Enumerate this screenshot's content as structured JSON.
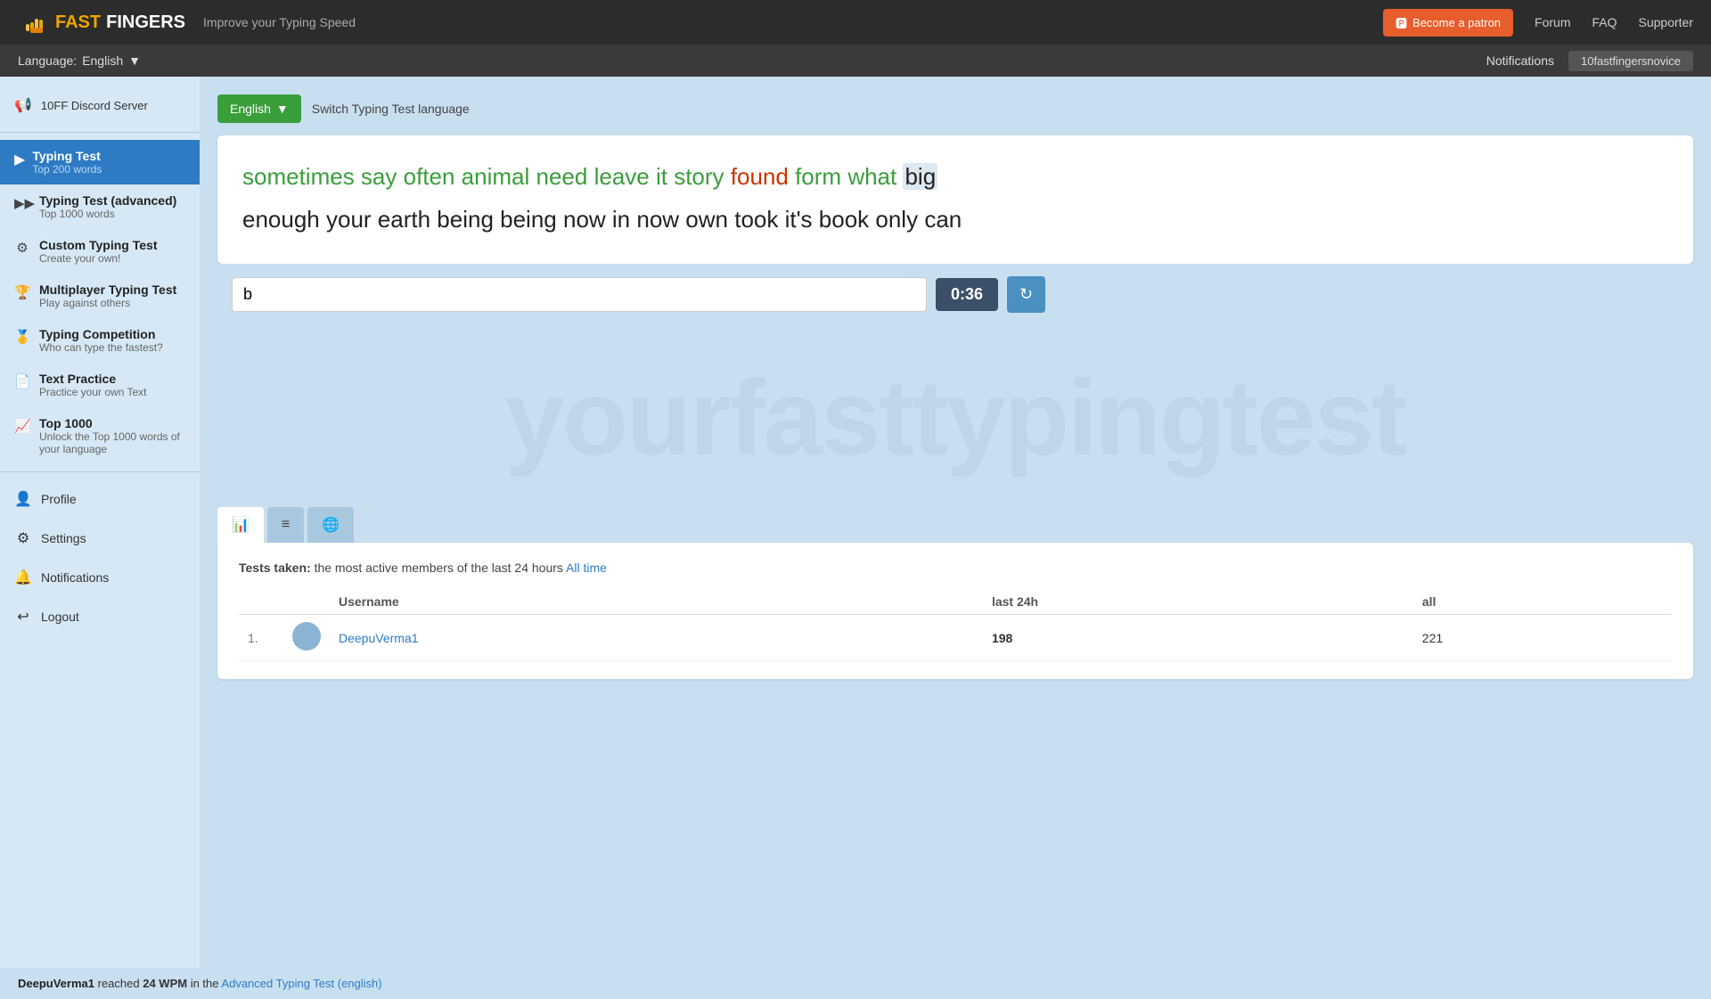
{
  "topbar": {
    "logo_fast": "FAST",
    "logo_fingers": "FINGERS",
    "tagline": "Improve your Typing Speed",
    "patron_btn": "Become a patron",
    "nav_forum": "Forum",
    "nav_faq": "FAQ",
    "nav_supporter": "Supporter"
  },
  "langbar": {
    "label": "Language:",
    "selected_lang": "English",
    "notifications": "Notifications",
    "username": "10fastfingersnovice"
  },
  "sidebar": {
    "discord": "10FF Discord Server",
    "items": [
      {
        "id": "typing-test",
        "title": "Typing Test",
        "sub": "Top 200 words",
        "active": true
      },
      {
        "id": "typing-test-advanced",
        "title": "Typing Test (advanced)",
        "sub": "Top 1000 words",
        "active": false
      },
      {
        "id": "custom-typing-test",
        "title": "Custom Typing Test",
        "sub": "Create your own!",
        "active": false
      },
      {
        "id": "multiplayer-typing-test",
        "title": "Multiplayer Typing Test",
        "sub": "Play against others",
        "active": false
      },
      {
        "id": "typing-competition",
        "title": "Typing Competition",
        "sub": "Who can type the fastest?",
        "active": false
      },
      {
        "id": "text-practice",
        "title": "Text Practice",
        "sub": "Practice your own Text",
        "active": false
      },
      {
        "id": "top-1000",
        "title": "Top 1000",
        "sub": "Unlock the Top 1000 words of your language",
        "active": false
      }
    ],
    "bottom_items": [
      {
        "id": "profile",
        "label": "Profile"
      },
      {
        "id": "settings",
        "label": "Settings"
      },
      {
        "id": "notifications",
        "label": "Notifications"
      },
      {
        "id": "logout",
        "label": "Logout"
      }
    ]
  },
  "typing_test": {
    "lang_btn": "English",
    "switch_text": "Switch Typing Test language",
    "words_line1": [
      {
        "text": "sometimes",
        "state": "green"
      },
      {
        "text": "say",
        "state": "green"
      },
      {
        "text": "often",
        "state": "green"
      },
      {
        "text": "animal",
        "state": "green"
      },
      {
        "text": "need",
        "state": "green"
      },
      {
        "text": "leave",
        "state": "green"
      },
      {
        "text": "it",
        "state": "green"
      },
      {
        "text": "story",
        "state": "green"
      },
      {
        "text": "found",
        "state": "red"
      },
      {
        "text": "form",
        "state": "green"
      },
      {
        "text": "what",
        "state": "green"
      },
      {
        "text": "big",
        "state": "highlighted"
      }
    ],
    "words_line2": [
      {
        "text": "enough",
        "state": "normal"
      },
      {
        "text": "your",
        "state": "normal"
      },
      {
        "text": "earth",
        "state": "normal"
      },
      {
        "text": "being",
        "state": "normal"
      },
      {
        "text": "being",
        "state": "normal"
      },
      {
        "text": "now",
        "state": "normal"
      },
      {
        "text": "in",
        "state": "normal"
      },
      {
        "text": "now",
        "state": "normal"
      },
      {
        "text": "own",
        "state": "normal"
      },
      {
        "text": "took",
        "state": "normal"
      },
      {
        "text": "it's",
        "state": "normal"
      },
      {
        "text": "book",
        "state": "normal"
      },
      {
        "text": "only",
        "state": "normal"
      },
      {
        "text": "can",
        "state": "normal"
      }
    ],
    "input_value": "b",
    "timer": "0:36",
    "watermark": "yourfasttypingtest"
  },
  "stats": {
    "tabs": [
      {
        "id": "bar-chart",
        "icon": "📊",
        "active": true
      },
      {
        "id": "list",
        "icon": "≡",
        "active": false
      },
      {
        "id": "globe",
        "icon": "🌐",
        "active": false
      }
    ],
    "header_text": "Tests taken:",
    "header_sub": "the most active members of the last 24 hours",
    "all_time_link": "All time",
    "columns": [
      "Username",
      "last 24h",
      "all"
    ],
    "rows": [
      {
        "rank": "1.",
        "username": "DeepuVerma1",
        "last24h": "198",
        "all": "221"
      }
    ]
  },
  "notification_bar": {
    "username": "DeepuVerma1",
    "action": "reached",
    "wpm": "24 WPM",
    "description": "in the",
    "link_text": "Advanced Typing Test (english)"
  }
}
